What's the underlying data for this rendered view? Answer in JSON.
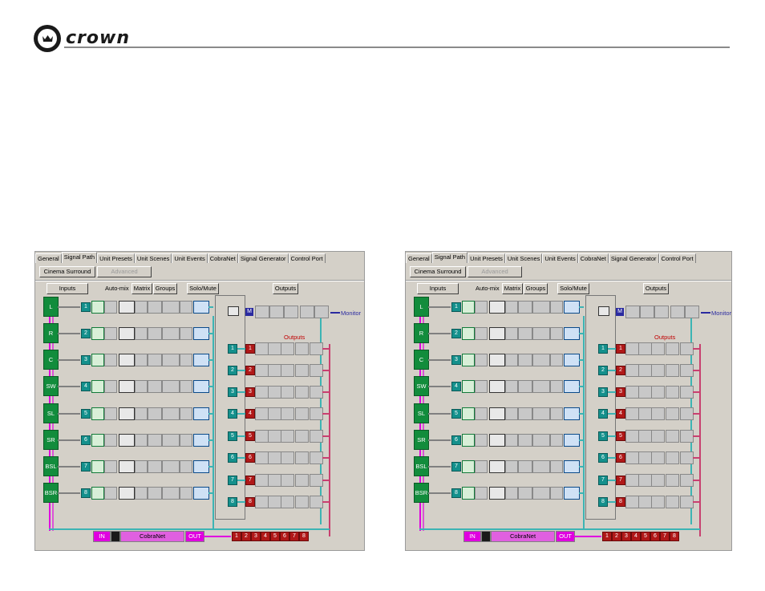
{
  "brand": {
    "name": "crown"
  },
  "left": {
    "tabs": [
      "General",
      "Signal Path",
      "Unit Presets",
      "Unit Scenes",
      "Unit Events",
      "CobraNet",
      "Signal Generator",
      "Control Port"
    ],
    "active_tab": "Signal Path",
    "mode_buttons": [
      "Cinema Surround",
      "Advanced"
    ],
    "section_buttons": {
      "inputs": "Inputs",
      "automix": "Auto-mix",
      "matrix": "Matrix",
      "groups": "Groups",
      "solo": "Solo/Mute",
      "outputs": "Outputs"
    },
    "inputs": [
      "L",
      "R",
      "C",
      "SW",
      "SL",
      "SR",
      "BSL",
      "BSR"
    ],
    "input_numbers": [
      "1",
      "2",
      "3",
      "4",
      "5",
      "6",
      "7",
      "8"
    ],
    "monitor": {
      "badge": "M",
      "label": "Monitor"
    },
    "outputs_label": "Outputs",
    "output_numbers": [
      "1",
      "2",
      "3",
      "4",
      "5",
      "6",
      "7",
      "8"
    ],
    "cobranet": {
      "in": "IN",
      "label": "CobraNet",
      "out": "OUT"
    },
    "cobranet_outputs": [
      "1",
      "2",
      "3",
      "4",
      "5",
      "6",
      "7",
      "8"
    ]
  },
  "right": {
    "tabs": [
      "General",
      "Signal Path",
      "Unit Presets",
      "Unit Scenes",
      "Unit Events",
      "CobraNet",
      "Signal Generator",
      "Control Port"
    ],
    "active_tab": "Signal Path",
    "mode_buttons": [
      "Cinema Surround",
      "Advanced"
    ],
    "section_buttons": {
      "inputs": "Inputs",
      "automix": "Auto-mix",
      "matrix": "Matrix",
      "groups": "Groups",
      "solo": "Solo/Mute",
      "outputs": "Outputs"
    },
    "inputs": [
      "L",
      "R",
      "C",
      "SW",
      "SL",
      "SR",
      "BSL",
      "BSR"
    ],
    "input_numbers": [
      "1",
      "2",
      "3",
      "4",
      "5",
      "6",
      "7",
      "8"
    ],
    "monitor": {
      "badge": "M",
      "label": "Monitor"
    },
    "outputs_label": "Outputs",
    "output_numbers": [
      "1",
      "2",
      "3",
      "4",
      "5",
      "6",
      "7",
      "8"
    ],
    "cobranet": {
      "in": "IN",
      "label": "CobraNet",
      "out": "OUT"
    },
    "cobranet_outputs": [
      "1",
      "2",
      "3",
      "4",
      "5",
      "6",
      "7",
      "8"
    ]
  },
  "colors": {
    "input_green": "#128c3c",
    "teal": "#14908c",
    "output_red": "#b01818",
    "magenta": "#e000e0",
    "wire_teal": "#3cb4b4",
    "wire_pink": "#c84070",
    "monitor_blue": "#2a2aa0"
  }
}
